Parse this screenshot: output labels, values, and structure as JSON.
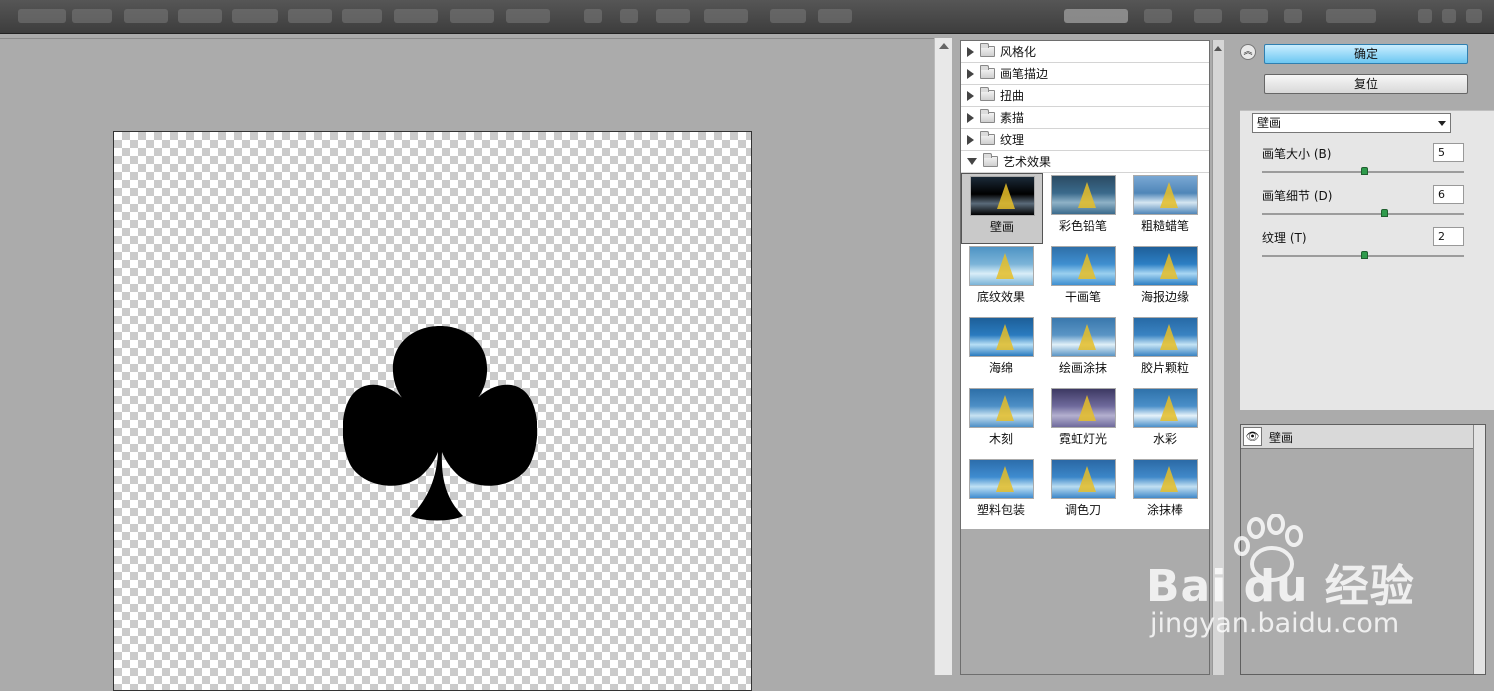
{
  "gallery": {
    "categories": [
      {
        "label": "风格化",
        "expanded": false
      },
      {
        "label": "画笔描边",
        "expanded": false
      },
      {
        "label": "扭曲",
        "expanded": false
      },
      {
        "label": "素描",
        "expanded": false
      },
      {
        "label": "纹理",
        "expanded": false
      },
      {
        "label": "艺术效果",
        "expanded": true
      }
    ],
    "thumbnails": [
      {
        "label": "壁画",
        "selected": true
      },
      {
        "label": "彩色铅笔"
      },
      {
        "label": "粗糙蜡笔"
      },
      {
        "label": "底纹效果"
      },
      {
        "label": "干画笔"
      },
      {
        "label": "海报边缘"
      },
      {
        "label": "海绵"
      },
      {
        "label": "绘画涂抹"
      },
      {
        "label": "胶片颗粒"
      },
      {
        "label": "木刻"
      },
      {
        "label": "霓虹灯光"
      },
      {
        "label": "水彩"
      },
      {
        "label": "塑料包装"
      },
      {
        "label": "调色刀"
      },
      {
        "label": "涂抹棒"
      }
    ]
  },
  "settings": {
    "ok_label": "确定",
    "reset_label": "复位",
    "filter_select": "壁画",
    "params": [
      {
        "label": "画笔大小 (B)",
        "value": "5",
        "level": 0.5
      },
      {
        "label": "画笔细节 (D)",
        "value": "6",
        "level": 0.6
      },
      {
        "label": "纹理 (T)",
        "value": "2",
        "level": 0.5
      }
    ]
  },
  "layers": {
    "effect_layer": "壁画"
  },
  "watermark": {
    "brand": "Bai du 经验",
    "url": "jingyan.baidu.com"
  },
  "colors": {
    "accent_button": "#6cc7f2",
    "slider_knob": "#2f9b4c",
    "workspace": "#ababab"
  }
}
